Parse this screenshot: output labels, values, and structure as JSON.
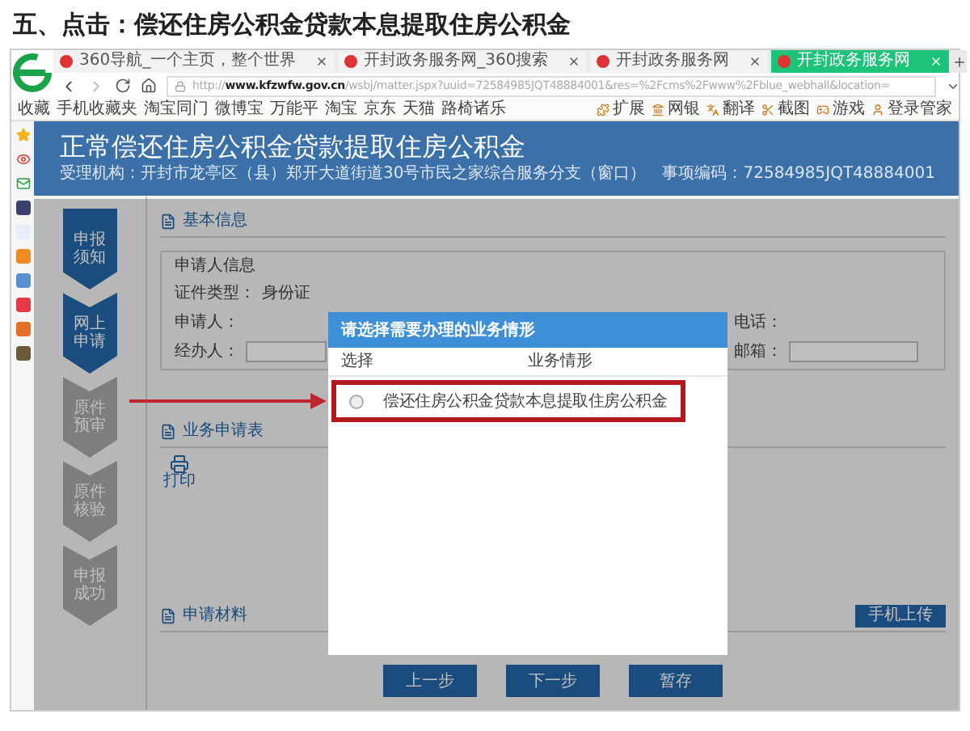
{
  "heading": "五、点击：偿还住房公积金贷款本息提取住房公积金",
  "browser": {
    "tabs": [
      {
        "label": "360导航_一个主页，整个世界",
        "selected": false
      },
      {
        "label": "开封政务服务网_360搜索",
        "selected": false
      },
      {
        "label": "开封政务服务网",
        "selected": false
      },
      {
        "label": "开封政务服务网",
        "selected": true
      }
    ],
    "url": "http://**www.kfzwfw.gov.cn**/wsbj/matter.jspx?uuid=72584985JQT48884001&res=%2Fcms%2Fwww%2Fblue_webhall&location=",
    "bookmarks": [
      "收藏",
      "手机收藏夹",
      "淘宝同门",
      "微博宝",
      "万能平",
      "淘宝",
      "京东",
      "天猫",
      "路椅诸乐"
    ],
    "tools": [
      "扩展",
      "网银",
      "翻译",
      "截图",
      "游戏",
      "登录管家"
    ]
  },
  "page": {
    "title": "正常偿还住房公积金贷款提取住房公积金",
    "agency": "受理机构：开封市龙亭区（县）郑开大道街道30号市民之家综合服务分支（窗口）",
    "item_code": "事项编码：72584985JQT48884001",
    "steps": [
      {
        "label": "申报须知",
        "active": true
      },
      {
        "label": "网上申请",
        "active": true
      },
      {
        "label": "原件预审",
        "active": false
      },
      {
        "label": "原件核验",
        "active": false
      },
      {
        "label": "申报成功",
        "active": false
      }
    ],
    "basic_info": "基本信息",
    "applicant_group": "申请人信息",
    "fields_left": [
      {
        "label": "证件类型：",
        "value": "身份证",
        "kind": "text"
      },
      {
        "label": "申请人：",
        "kind": "none"
      },
      {
        "label": "经办人：",
        "kind": "input"
      }
    ],
    "fields_right": [
      {
        "label": "电话：",
        "kind": "none"
      },
      {
        "label": "邮箱：",
        "kind": "input"
      }
    ],
    "form_section": "业务申请表",
    "print": "打印",
    "materials": "申请材料",
    "upload": "手机上传",
    "buttons": [
      "上一步",
      "下一步",
      "暂存"
    ]
  },
  "dialog": {
    "title": "请选择需要办理的业务情形",
    "columns": [
      "选择",
      "业务情形"
    ],
    "rows": [
      {
        "label": "偿还住房公积金贷款本息提取住房公积金",
        "selected": false
      }
    ]
  }
}
